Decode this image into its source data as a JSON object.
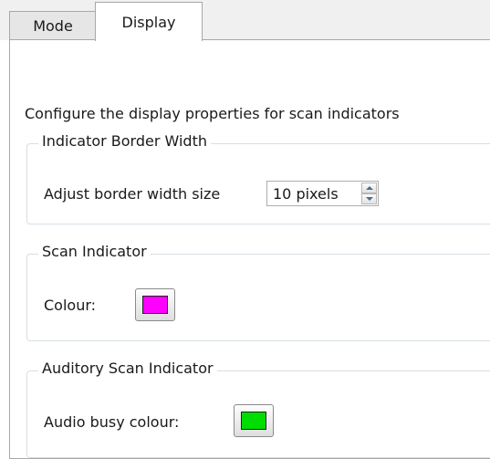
{
  "tabs": [
    {
      "label": "Mode"
    },
    {
      "label": "Display"
    }
  ],
  "intro": "Configure the display properties for scan indicators",
  "border_width_group": {
    "legend": "Indicator Border Width",
    "label": "Adjust border width size",
    "value": "10 pixels"
  },
  "scan_indicator_group": {
    "legend": "Scan Indicator",
    "label": "Colour:",
    "colour": "#ff00ff"
  },
  "auditory_group": {
    "legend": "Auditory Scan Indicator",
    "label": "Audio busy colour:",
    "colour": "#00dd00"
  },
  "icons": {
    "spin_up": "chevron-up-icon",
    "spin_down": "chevron-down-icon"
  }
}
